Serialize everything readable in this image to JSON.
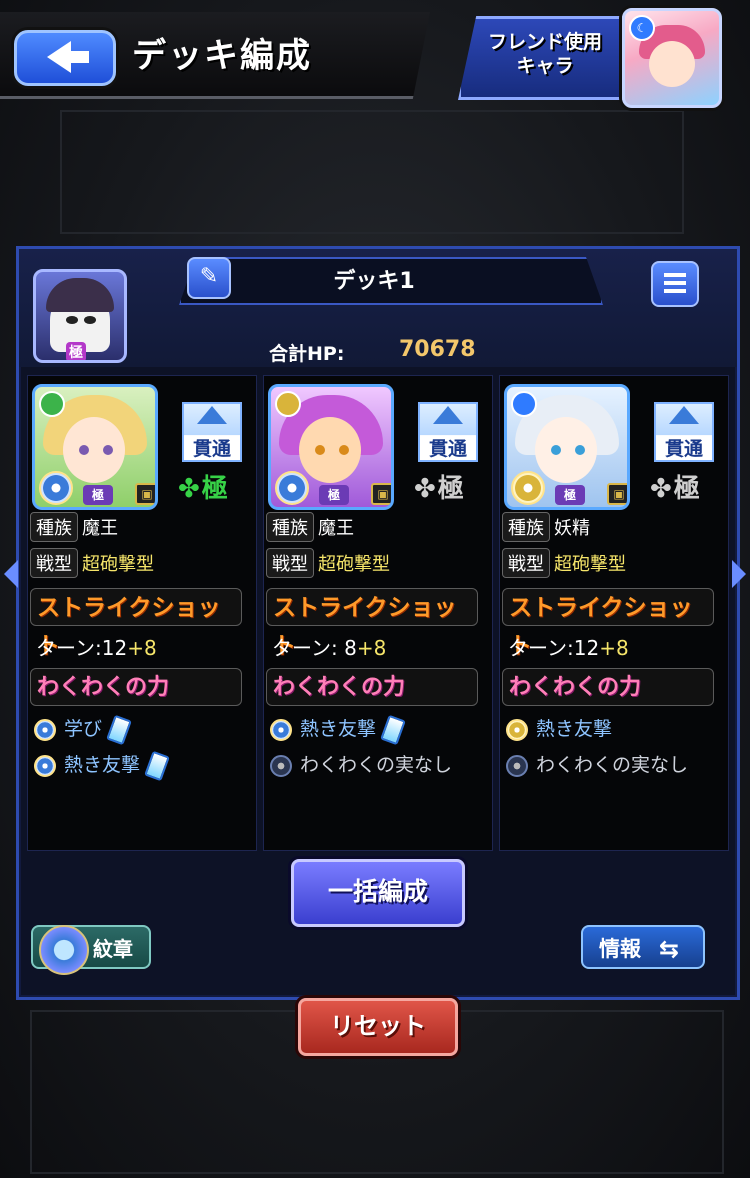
{
  "header": {
    "title": "デッキ編成",
    "friend_button": "フレンド使用\nキャラ"
  },
  "deck": {
    "name": "デッキ1",
    "total_hp_label": "合計HP:",
    "total_hp_value": "70678",
    "leader_badge": "極"
  },
  "units": [
    {
      "skill": "貫通",
      "luck": "極",
      "luck_color": "#37d247",
      "race_label": "種族",
      "race": "魔王",
      "type_label": "戦型",
      "type": "超砲撃型",
      "strike_shot": "ストライクショット",
      "turn_label": "ターン:12",
      "turn_plus": "+8",
      "waku_title": "わくわくの力",
      "waku": [
        {
          "name": "学び",
          "potion": true
        },
        {
          "name": "熱き友撃",
          "potion": true
        }
      ]
    },
    {
      "skill": "貫通",
      "luck": "極",
      "luck_color": "#cfcfcf",
      "race_label": "種族",
      "race": "魔王",
      "type_label": "戦型",
      "type": "超砲撃型",
      "strike_shot": "ストライクショット",
      "turn_label": "ターン: 8",
      "turn_plus": "+8",
      "waku_title": "わくわくの力",
      "waku": [
        {
          "name": "熱き友撃",
          "potion": true
        },
        {
          "name": "わくわくの実なし",
          "potion": false
        }
      ]
    },
    {
      "skill": "貫通",
      "luck": "極",
      "luck_color": "#cfcfcf",
      "race_label": "種族",
      "race": "妖精",
      "type_label": "戦型",
      "type": "超砲撃型",
      "strike_shot": "ストライクショット",
      "turn_label": "ターン:12",
      "turn_plus": "+8",
      "waku_title": "わくわくの力",
      "waku": [
        {
          "name": "熱き友撃",
          "potion": false
        },
        {
          "name": "わくわくの実なし",
          "potion": false
        }
      ]
    }
  ],
  "buttons": {
    "bulk": "一括編成",
    "emblem": "紋章",
    "info": "情報",
    "info_icon": "⇆",
    "reset": "リセット"
  }
}
